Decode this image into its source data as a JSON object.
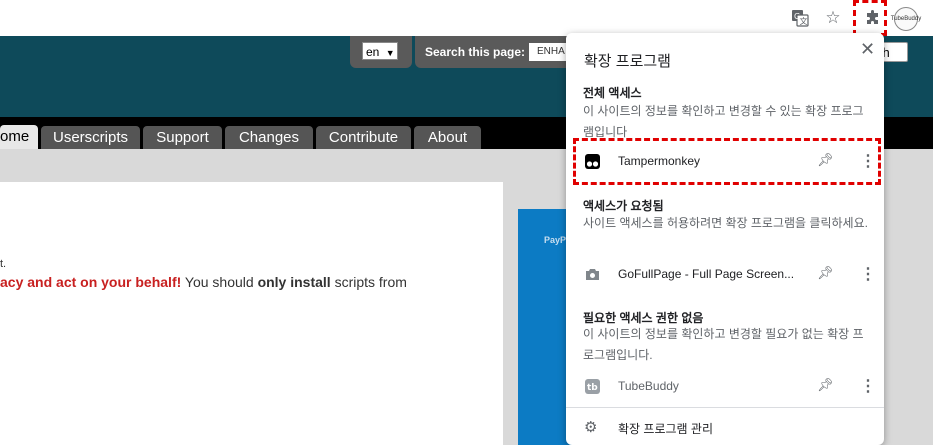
{
  "toolbar": {
    "icons": [
      "translate-icon",
      "star-icon",
      "puzzle-extensions-icon",
      "profile-avatar"
    ],
    "avatar_text": "TubeBuddy"
  },
  "header": {
    "lang_value": "en",
    "search_label": "Search this page:",
    "search_value": "ENHA",
    "search_button_partial": "ch"
  },
  "nav": {
    "tabs": [
      "ome",
      "Userscripts",
      "Support",
      "Changes",
      "Contribute",
      "About"
    ]
  },
  "page": {
    "t_mark": "t.",
    "warn_text": "acy and act on your behalf!",
    "text_1": " You should ",
    "strong_text": "only install",
    "text_2": " scripts from",
    "paypal_text": "PayP"
  },
  "popup": {
    "title": "확장 프로그램",
    "close_label": "✕",
    "full_access": {
      "heading": "전체 액세스",
      "description": "이 사이트의 정보를 확인하고 변경할 수 있는 확장 프로그램입니다"
    },
    "requested": {
      "heading": "액세스가 요청됨",
      "description": "사이트 액세스를 허용하려면 확장 프로그램을 클릭하세요."
    },
    "no_access": {
      "heading": "필요한 액세스 권한 없음",
      "description": "이 사이트의 정보를 확인하고 변경할 필요가 없는 확장 프로그램입니다."
    },
    "extensions": [
      {
        "name": "Tampermonkey",
        "icon": "tampermonkey-icon"
      },
      {
        "name": "GoFullPage - Full Page Screen...",
        "icon": "camera-icon"
      },
      {
        "name": "TubeBuddy",
        "icon": "tubebuddy-icon"
      }
    ],
    "manage_label": "확장 프로그램 관리"
  },
  "colors": {
    "header_bg": "#0e4a5a",
    "highlight": "#e00000",
    "warn_red": "#c82020",
    "paypal_blue": "#0c7bc4"
  }
}
